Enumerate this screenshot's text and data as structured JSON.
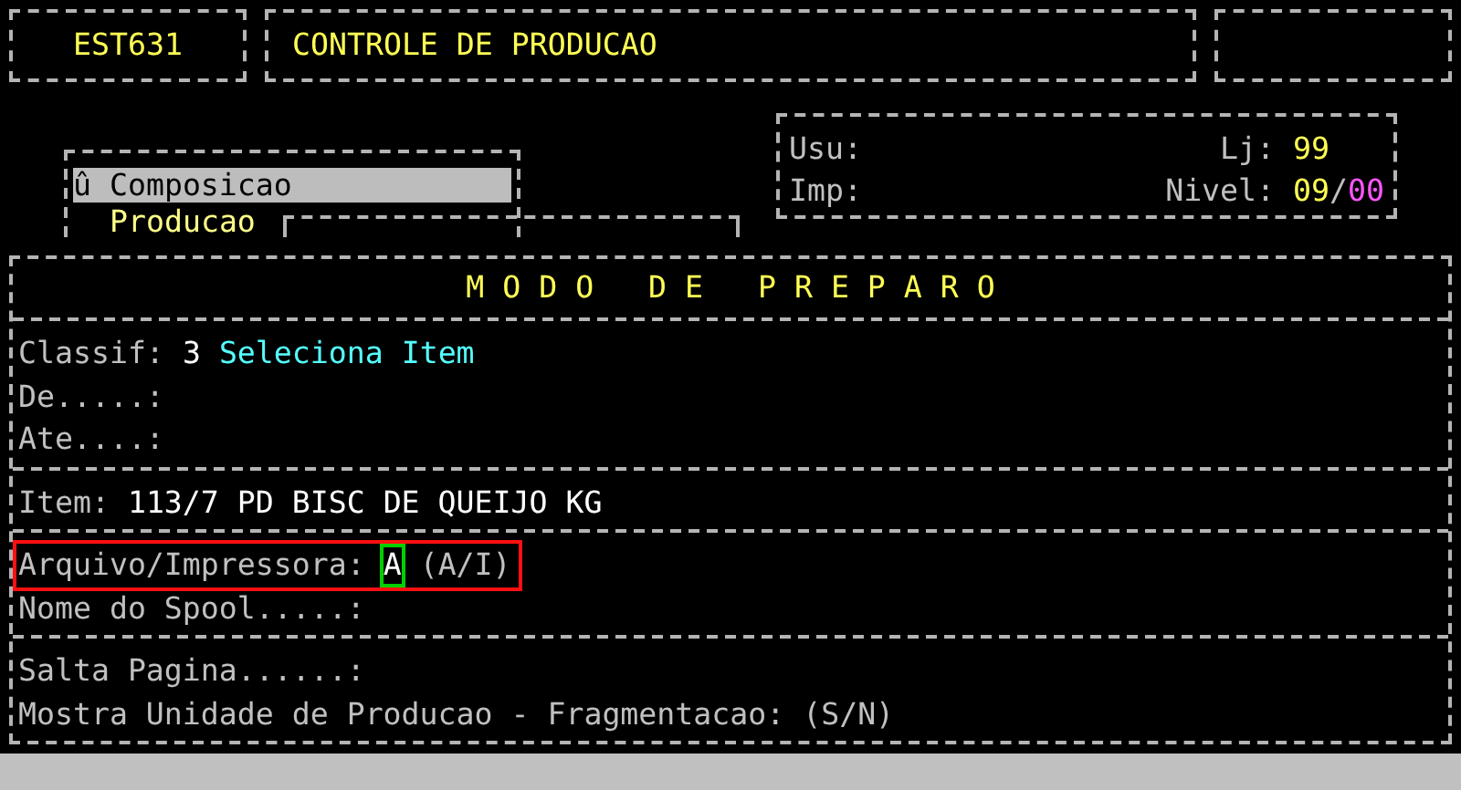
{
  "header": {
    "program": "EST631",
    "title": "CONTROLE DE PRODUCAO"
  },
  "menu": {
    "items": [
      {
        "label": "û Composicao",
        "selected": true
      },
      {
        "label": "Producao",
        "selected": false
      }
    ]
  },
  "info": {
    "user_label": "Usu:",
    "printer_label": "Imp:",
    "store_label": "Lj:",
    "store": "99",
    "level_label": "Nivel:",
    "level_major": "09",
    "level_separator": "/",
    "level_minor": "00"
  },
  "form": {
    "title": "M O D O   D E   P R E P A R O",
    "sections": [
      {
        "lines": [
          {
            "highlighted": false,
            "parts": [
              {
                "kind": "label",
                "text": "Classif:"
              },
              {
                "kind": "value",
                "text": "3"
              },
              {
                "kind": "description",
                "text": "Seleciona Item"
              }
            ]
          },
          {
            "highlighted": false,
            "parts": [
              {
                "kind": "label",
                "text": "De.....:"
              }
            ]
          },
          {
            "highlighted": false,
            "parts": [
              {
                "kind": "label",
                "text": "Ate....:"
              }
            ]
          }
        ]
      },
      {
        "lines": [
          {
            "highlighted": false,
            "parts": [
              {
                "kind": "label",
                "text": "Item:"
              },
              {
                "kind": "value",
                "text": "113/7 PD BISC DE QUEIJO KG"
              }
            ]
          }
        ]
      },
      {
        "lines": [
          {
            "highlighted": true,
            "parts": [
              {
                "kind": "label",
                "text": "Arquivo/Impressora:"
              },
              {
                "kind": "input",
                "text": "A"
              },
              {
                "kind": "label",
                "text": "(A/I)"
              }
            ]
          },
          {
            "highlighted": false,
            "parts": [
              {
                "kind": "label",
                "text": "Nome do Spool.....:"
              }
            ]
          }
        ]
      },
      {
        "lines": [
          {
            "highlighted": false,
            "parts": [
              {
                "kind": "label",
                "text": "Salta Pagina......:"
              }
            ]
          },
          {
            "highlighted": false,
            "parts": [
              {
                "kind": "label",
                "text": "Mostra Unidade de Producao - Fragmentacao:"
              },
              {
                "kind": "label",
                "text": "(S/N)"
              }
            ]
          }
        ]
      }
    ]
  }
}
